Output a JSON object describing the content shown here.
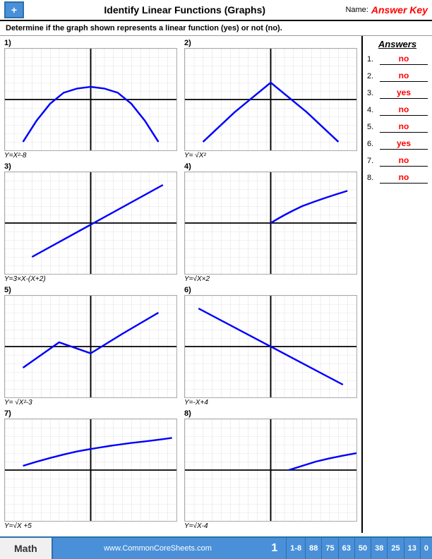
{
  "header": {
    "title": "Identify Linear Functions (Graphs)",
    "name_label": "Name:",
    "answer_key": "Answer Key",
    "logo_symbol": "+"
  },
  "instructions": "Determine if the graph shown represents a linear function (yes) or not (no).",
  "answers_title": "Answers",
  "answers": [
    {
      "num": "1.",
      "value": "no"
    },
    {
      "num": "2.",
      "value": "no"
    },
    {
      "num": "3.",
      "value": "yes"
    },
    {
      "num": "4.",
      "value": "no"
    },
    {
      "num": "5.",
      "value": "no"
    },
    {
      "num": "6.",
      "value": "yes"
    },
    {
      "num": "7.",
      "value": "no"
    },
    {
      "num": "8.",
      "value": "no"
    }
  ],
  "graphs": [
    {
      "num": "1)",
      "label": "Y=X²-8",
      "type": "parabola_up"
    },
    {
      "num": "2)",
      "label": "Y= √X²",
      "type": "abs_value"
    },
    {
      "num": "3)",
      "label": "Y=3×X-(X+2)",
      "type": "linear_pos"
    },
    {
      "num": "4)",
      "label": "Y=√X×2",
      "type": "sqrt_curve"
    },
    {
      "num": "5)",
      "label": "Y= √X²-3",
      "type": "abs_shifted"
    },
    {
      "num": "6)",
      "label": "Y=-X+4",
      "type": "linear_neg"
    },
    {
      "num": "7)",
      "label": "Y=√X  +5",
      "type": "sqrt_shifted"
    },
    {
      "num": "8)",
      "label": "Y=√X-4",
      "type": "sqrt_right"
    }
  ],
  "footer": {
    "math_label": "Math",
    "url": "www.CommonCoreSheets.com",
    "page": "1",
    "stats": [
      {
        "label": "1-8",
        "value": "1-8"
      },
      {
        "label": "",
        "value": "88"
      },
      {
        "label": "",
        "value": "75"
      },
      {
        "label": "",
        "value": "63"
      },
      {
        "label": "",
        "value": "50"
      },
      {
        "label": "",
        "value": "38"
      },
      {
        "label": "",
        "value": "25"
      },
      {
        "label": "",
        "value": "13"
      },
      {
        "label": "",
        "value": "0"
      }
    ]
  }
}
